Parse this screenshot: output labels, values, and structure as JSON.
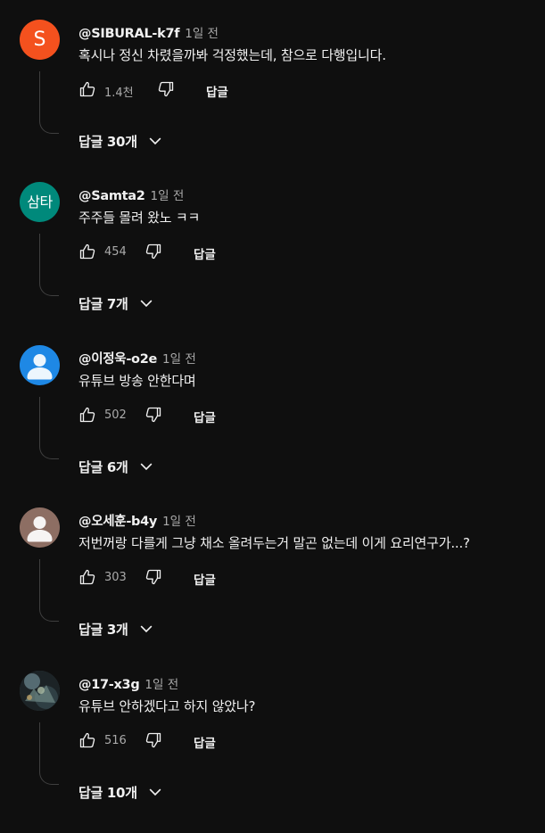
{
  "comments": [
    {
      "avatar_type": "letter",
      "avatar_letter": "S",
      "avatar_color": "#f4511e",
      "handle": "@SIBURAL-k7f",
      "time": "1일 전",
      "text": "혹시나 정신 차렸을까봐 걱정했는데, 참으로 다행입니다.",
      "likes": "1.4천",
      "reply_label": "답글",
      "replies_label": "답글 30개"
    },
    {
      "avatar_type": "text",
      "avatar_text": "삼타",
      "avatar_color": "#00897b",
      "handle": "@Samta2",
      "time": "1일 전",
      "text": "주주들 몰려 왔노 ㅋㅋ",
      "likes": "454",
      "reply_label": "답글",
      "replies_label": "답글 7개"
    },
    {
      "avatar_type": "default",
      "avatar_color": "#1e88e5",
      "handle": "@이정욱-o2e",
      "time": "1일 전",
      "text": "유튜브 방송 안한다며",
      "likes": "502",
      "reply_label": "답글",
      "replies_label": "답글 6개"
    },
    {
      "avatar_type": "default",
      "avatar_color": "#8d6e63",
      "handle": "@오세훈-b4y",
      "time": "1일 전",
      "text": "저번꺼랑 다를게 그냥 채소 올려두는거 말곤 없는데 이게 요리연구가...?",
      "likes": "303",
      "reply_label": "답글",
      "replies_label": "답글 3개"
    },
    {
      "avatar_type": "photo",
      "avatar_color": "#3a4a4f",
      "handle": "@17-x3g",
      "time": "1일 전",
      "text": "유튜브 안하겠다고 하지 않았나?",
      "likes": "516",
      "reply_label": "답글",
      "replies_label": "답글 10개"
    }
  ],
  "icons": {
    "like": "thumb-up-icon",
    "dislike": "thumb-down-icon",
    "expand": "chevron-down-icon"
  },
  "colors": {
    "background": "#0f0f0f",
    "text_primary": "#f1f1f1",
    "text_secondary": "#aaaaaa"
  }
}
